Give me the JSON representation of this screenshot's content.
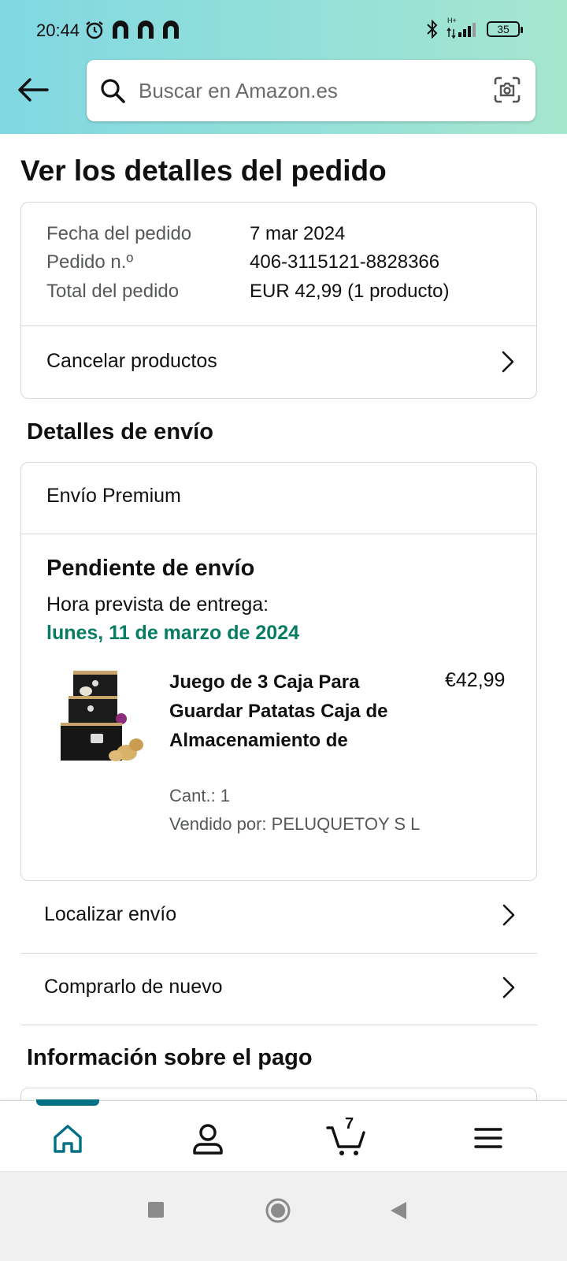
{
  "status_bar": {
    "time": "20:44",
    "battery": "35",
    "network": "H+"
  },
  "search": {
    "placeholder": "Buscar en Amazon.es"
  },
  "page_title": "Ver los detalles del pedido",
  "order": {
    "rows": [
      {
        "label": "Fecha del pedido",
        "value": "7 mar 2024"
      },
      {
        "label": "Pedido n.º",
        "value": "406-3115121-8828366"
      },
      {
        "label": "Total del pedido",
        "value": "EUR 42,99 (1 producto)"
      }
    ],
    "cancel_label": "Cancelar productos"
  },
  "shipping": {
    "heading": "Detalles de envío",
    "type": "Envío Premium",
    "status": "Pendiente de envío",
    "eta_label": "Hora prevista de entrega:",
    "eta_date": "lunes, 11 de marzo de 2024",
    "product": {
      "title": "Juego de 3 Caja Para Guardar Patatas Caja de Almacenamiento de",
      "price": "€42,99",
      "qty": "Cant.: 1",
      "seller": "Vendido por: PELUQUETOY S L"
    }
  },
  "links": {
    "track": "Localizar envío",
    "buy_again": "Comprarlo de nuevo"
  },
  "payment": {
    "heading": "Información sobre el pago"
  },
  "nav": {
    "cart_count": "7",
    "accent": "#007185"
  },
  "colors": {
    "eta_green": "#067d62",
    "muted": "#565959",
    "border": "#d5d9d9"
  }
}
